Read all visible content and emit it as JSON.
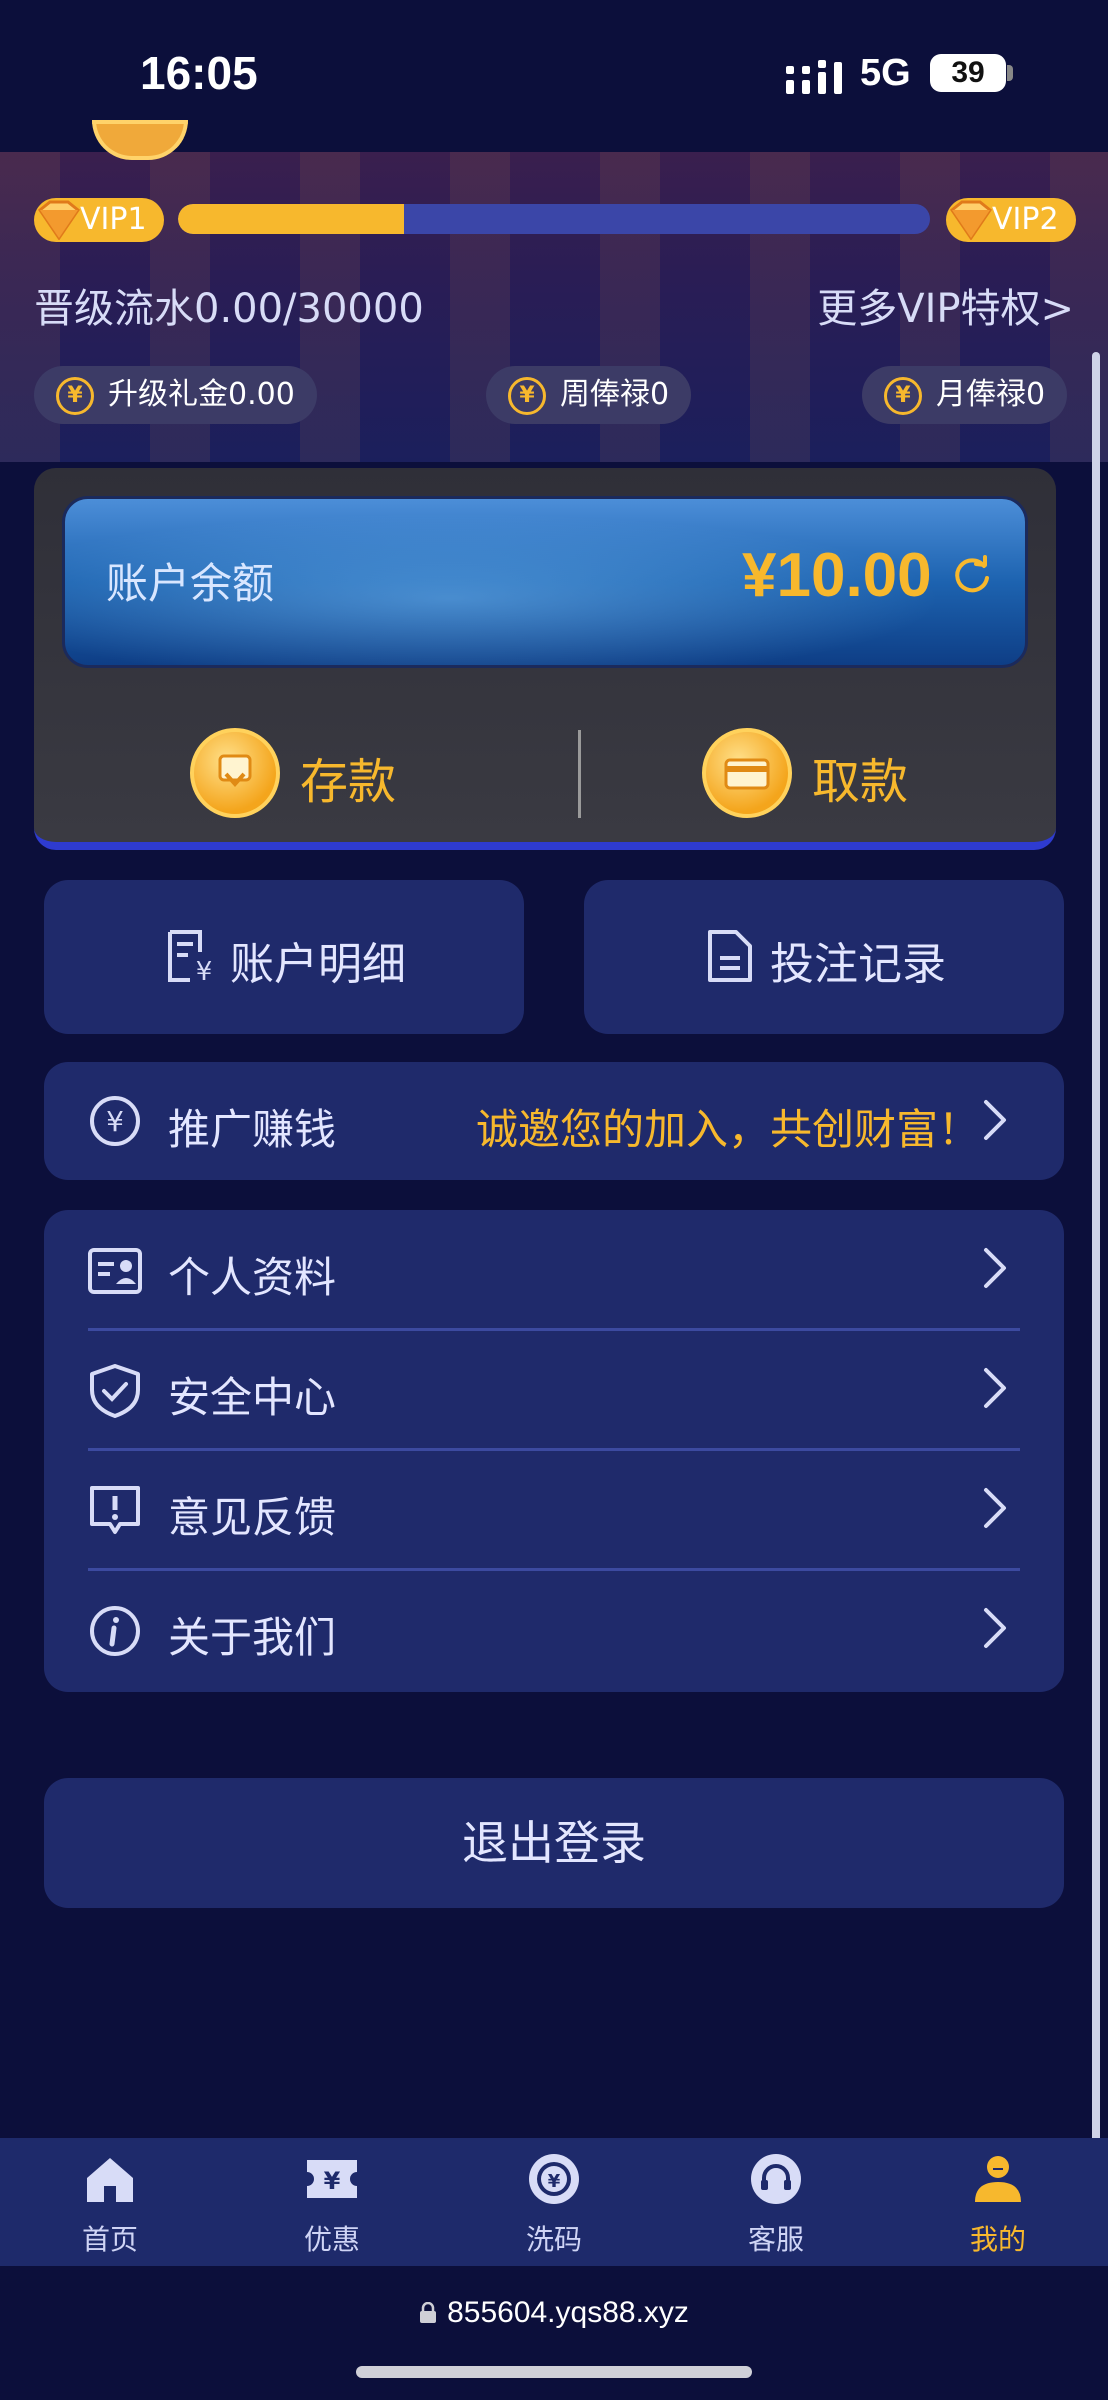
{
  "status_bar": {
    "time": "16:05",
    "network": "5G",
    "battery": "39"
  },
  "vip": {
    "current_level": "VIP1",
    "next_level": "VIP2",
    "progress_fraction": 0.3,
    "turnover_text": "晋级流水0.00/30000",
    "more_privileges": "更多VIP特权>",
    "chips": [
      {
        "label": "升级礼金0.00",
        "icon": "diamond-yen-icon"
      },
      {
        "label": "周俸禄0",
        "icon": "yen-coin-icon"
      },
      {
        "label": "月俸禄0",
        "icon": "yen-coin-icon"
      }
    ]
  },
  "wallet": {
    "balance_label": "账户余额",
    "balance_value": "¥10.00",
    "deposit_label": "存款",
    "withdraw_label": "取款"
  },
  "tiles": [
    {
      "label": "账户明细",
      "icon": "receipt-yen-icon"
    },
    {
      "label": "投注记录",
      "icon": "document-icon"
    }
  ],
  "promo": {
    "title": "推广赚钱",
    "slogan": "诚邀您的加入，共创财富！",
    "icon": "yen-circle-icon"
  },
  "menu": [
    {
      "label": "个人资料",
      "icon": "id-card-icon"
    },
    {
      "label": "安全中心",
      "icon": "shield-check-icon"
    },
    {
      "label": "意见反馈",
      "icon": "feedback-icon"
    },
    {
      "label": "关于我们",
      "icon": "info-icon"
    }
  ],
  "logout_label": "退出登录",
  "tabbar": [
    {
      "label": "首页",
      "icon": "home-icon",
      "active": false
    },
    {
      "label": "优惠",
      "icon": "ticket-yen-icon",
      "active": false
    },
    {
      "label": "洗码",
      "icon": "chip-icon",
      "active": false
    },
    {
      "label": "客服",
      "icon": "headset-icon",
      "active": false
    },
    {
      "label": "我的",
      "icon": "user-icon",
      "active": true
    }
  ],
  "browser": {
    "url": "855604.yqs88.xyz"
  },
  "colors": {
    "accent": "#f7b82d",
    "card": "#1f2a6b",
    "background": "#0c0f3b"
  }
}
